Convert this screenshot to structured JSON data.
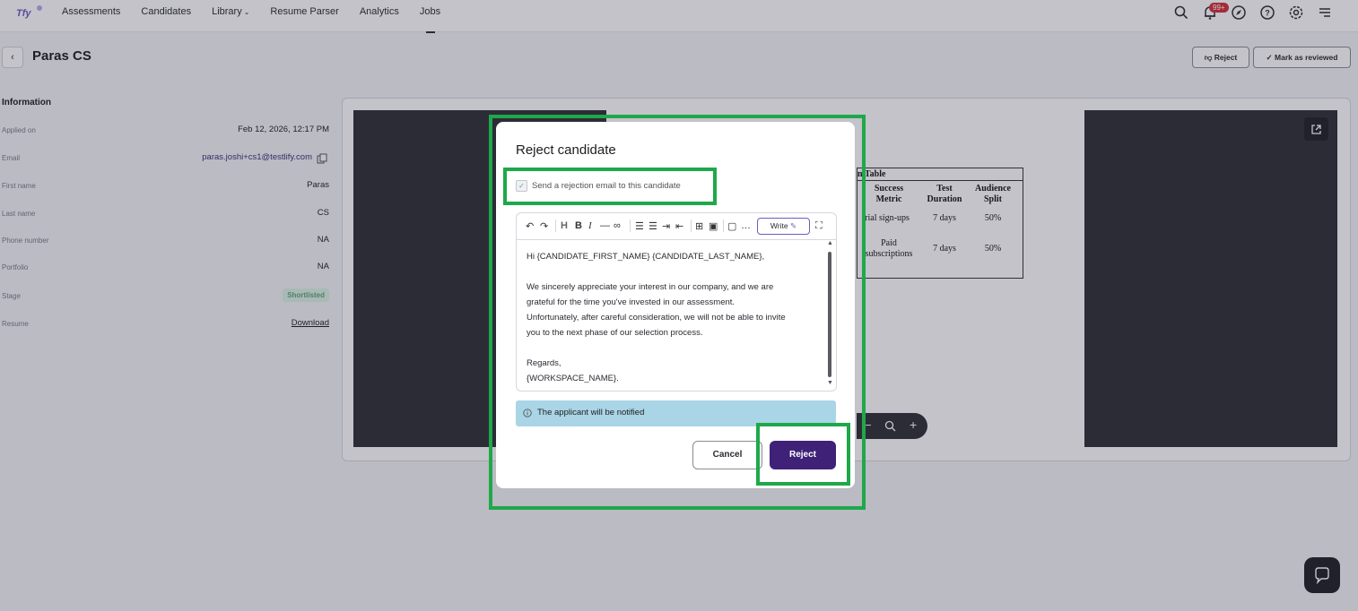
{
  "nav": {
    "items": [
      {
        "label": "Assessments"
      },
      {
        "label": "Candidates"
      },
      {
        "label": "Library"
      },
      {
        "label": "Resume Parser"
      },
      {
        "label": "Analytics"
      },
      {
        "label": "Jobs"
      }
    ],
    "active": "Jobs",
    "notification_badge": "99+",
    "icons": [
      "search-icon",
      "bell-icon",
      "compass-icon",
      "help-icon",
      "gear-icon",
      "menu-icon"
    ]
  },
  "page": {
    "title": "Paras CS",
    "reject_label": "Reject",
    "mark_reviewed_label": "Mark as reviewed"
  },
  "info": {
    "heading": "Information",
    "rows": [
      {
        "label": "Applied on",
        "value": "Feb 12, 2026, 12:17 PM"
      },
      {
        "label": "Email",
        "value": "paras.joshi+cs1@testlify.com"
      },
      {
        "label": "First name",
        "value": "Paras"
      },
      {
        "label": "Last name",
        "value": "CS"
      },
      {
        "label": "Phone number",
        "value": "NA"
      },
      {
        "label": "Portfolio",
        "value": "NA"
      },
      {
        "label": "Stage",
        "value": "Shortlisted"
      },
      {
        "label": "Resume",
        "value": "Download"
      }
    ]
  },
  "pdf_table": {
    "title": "n Table",
    "headers": [
      "Success Metric",
      "Test Duration",
      "Audience Split"
    ],
    "rows": [
      [
        "rial sign-ups",
        "7 days",
        "50%"
      ],
      [
        "Paid subscriptions",
        "7 days",
        "50%"
      ]
    ]
  },
  "modal": {
    "title": "Reject candidate",
    "checkbox_label": "Send a rejection email to this candidate",
    "checkbox_checked": true,
    "write_label": "Write",
    "body": [
      "Hi {CANDIDATE_FIRST_NAME} {CANDIDATE_LAST_NAME},",
      "",
      "We sincerely appreciate your interest in our company, and we are",
      "grateful for the time you've invested in our assessment.",
      "Unfortunately, after careful consideration, we will not be able to invite",
      "you to the next phase of our selection process.",
      "",
      "Regards,",
      "{WORKSPACE_NAME}."
    ],
    "notice": "The applicant will be notified",
    "cancel_label": "Cancel",
    "reject_label": "Reject"
  },
  "colors": {
    "primary": "#3f2178",
    "highlight": "#1fa84a",
    "notice_bg": "#a9d5e6",
    "badge": "#d62b3a"
  }
}
